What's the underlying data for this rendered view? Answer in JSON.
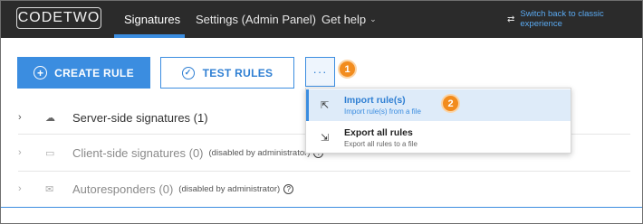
{
  "nav": {
    "logo": "CODETWO",
    "items": [
      {
        "label": "Signatures"
      },
      {
        "label": "Settings (Admin Panel)"
      },
      {
        "label": "Get help"
      }
    ],
    "switch_label": "Switch back to classic experience"
  },
  "toolbar": {
    "create_label": "CREATE RULE",
    "test_label": "TEST RULES",
    "more_label": "···"
  },
  "badges": [
    "1",
    "2"
  ],
  "menu": {
    "items": [
      {
        "title": "Import rule(s)",
        "subtitle": "Import rule(s) from a file"
      },
      {
        "title": "Export all rules",
        "subtitle": "Export all rules to a file"
      }
    ]
  },
  "sections": [
    {
      "label": "Server-side signatures (1)",
      "note": ""
    },
    {
      "label": "Client-side signatures (0)",
      "note": "(disabled by administrator)"
    },
    {
      "label": "Autoresponders (0)",
      "note": "(disabled by administrator)"
    }
  ],
  "colors": {
    "accent": "#3b8de0",
    "badge": "#f28c1e",
    "topbar": "#2b2b2b"
  }
}
